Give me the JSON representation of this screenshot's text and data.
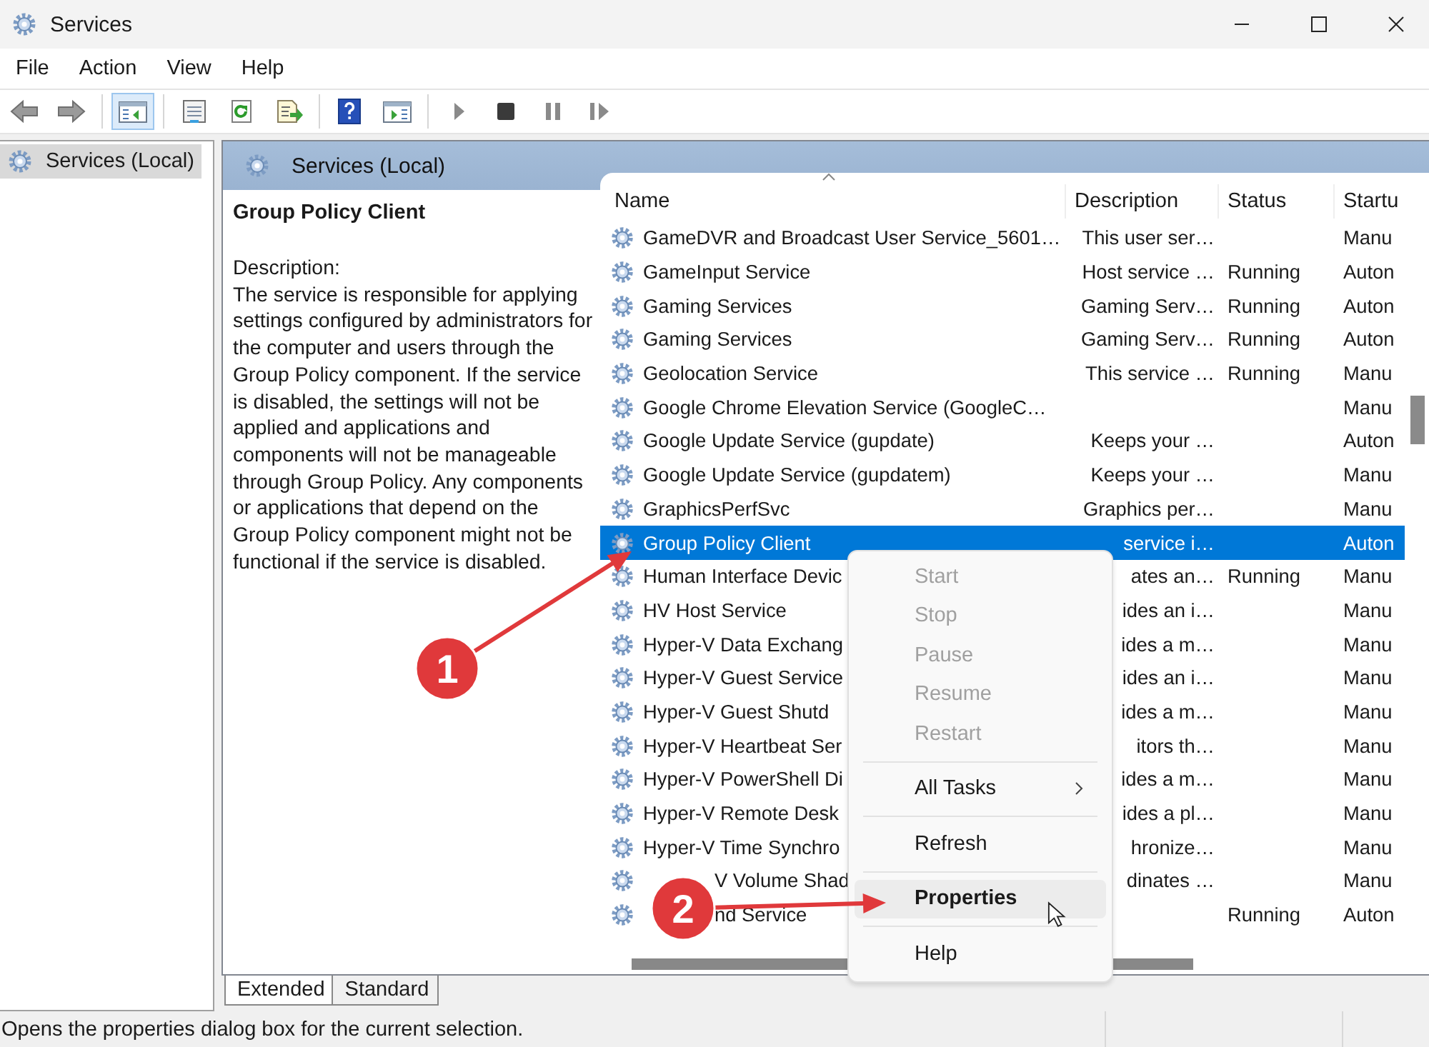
{
  "window": {
    "title": "Services"
  },
  "menu": [
    "File",
    "Action",
    "View",
    "Help"
  ],
  "toolbar": [
    {
      "kind": "back",
      "pressed": false
    },
    {
      "kind": "forward",
      "pressed": false
    },
    {
      "kind": "tree",
      "pressed": true
    },
    {
      "kind": "properties",
      "pressed": false
    },
    {
      "kind": "refresh",
      "pressed": false
    },
    {
      "kind": "export",
      "pressed": false
    },
    {
      "kind": "help",
      "pressed": false
    },
    {
      "kind": "pane",
      "pressed": false
    },
    {
      "kind": "play",
      "pressed": false
    },
    {
      "kind": "stop",
      "pressed": false
    },
    {
      "kind": "pause",
      "pressed": false
    },
    {
      "kind": "resume",
      "pressed": false
    }
  ],
  "tree": {
    "items": [
      {
        "label": "Services (Local)",
        "selected": true
      }
    ]
  },
  "pane_title": "Services (Local)",
  "detail": {
    "title": "Group Policy Client",
    "label": "Description:",
    "text": "The service is responsible for applying settings configured by administrators for the computer and users through the Group Policy component. If the service is disabled, the settings will not be applied and applications and components will not be manageable through Group Policy. Any components or applications that depend on the Group Policy component might not be functional if the service is disabled."
  },
  "table": {
    "columns": [
      "Name",
      "Description",
      "Status",
      "Startu"
    ],
    "rows": [
      {
        "name": "GameDVR and Broadcast User Service_5601…",
        "description": "This user ser…",
        "status": "",
        "startup": "Manu",
        "selected": false
      },
      {
        "name": "GameInput Service",
        "description": "Host service …",
        "status": "Running",
        "startup": "Auton",
        "selected": false
      },
      {
        "name": "Gaming Services",
        "description": "Gaming Serv…",
        "status": "Running",
        "startup": "Auton",
        "selected": false
      },
      {
        "name": "Gaming Services",
        "description": "Gaming Serv…",
        "status": "Running",
        "startup": "Auton",
        "selected": false
      },
      {
        "name": "Geolocation Service",
        "description": "This service …",
        "status": "Running",
        "startup": "Manu",
        "selected": false
      },
      {
        "name": "Google Chrome Elevation Service (GoogleC…",
        "description": "",
        "status": "",
        "startup": "Manu",
        "selected": false
      },
      {
        "name": "Google Update Service (gupdate)",
        "description": "Keeps your …",
        "status": "",
        "startup": "Auton",
        "selected": false
      },
      {
        "name": "Google Update Service (gupdatem)",
        "description": "Keeps your …",
        "status": "",
        "startup": "Manu",
        "selected": false
      },
      {
        "name": "GraphicsPerfSvc",
        "description": "Graphics per…",
        "status": "",
        "startup": "Manu",
        "selected": false
      },
      {
        "name": "Group Policy Client",
        "description": "service i…",
        "status": "",
        "startup": "Auton",
        "selected": true
      },
      {
        "name": "Human Interface Devic",
        "description": "ates an…",
        "status": "Running",
        "startup": "Manu",
        "selected": false
      },
      {
        "name": "HV Host Service",
        "description": "ides an i…",
        "status": "",
        "startup": "Manu",
        "selected": false
      },
      {
        "name": "Hyper-V Data Exchang",
        "description": "ides a m…",
        "status": "",
        "startup": "Manu",
        "selected": false
      },
      {
        "name": "Hyper-V Guest Service",
        "description": "ides an i…",
        "status": "",
        "startup": "Manu",
        "selected": false
      },
      {
        "name": "Hyper-V Guest Shutd",
        "description": "ides a m…",
        "status": "",
        "startup": "Manu",
        "selected": false
      },
      {
        "name": "Hyper-V Heartbeat Ser",
        "description": "itors th…",
        "status": "",
        "startup": "Manu",
        "selected": false
      },
      {
        "name": "Hyper-V PowerShell Di",
        "description": "ides a m…",
        "status": "",
        "startup": "Manu",
        "selected": false
      },
      {
        "name": "Hyper-V Remote Desk",
        "description": "ides a pl…",
        "status": "",
        "startup": "Manu",
        "selected": false
      },
      {
        "name": "Hyper-V Time Synchro",
        "description": "hronize…",
        "status": "",
        "startup": "Manu",
        "selected": false
      },
      {
        "name": "V Volume Shad",
        "description": "dinates …",
        "status": "",
        "startup": "Manu",
        "selected": false
      },
      {
        "name": "nd Service",
        "description": "",
        "status": "Running",
        "startup": "Auton",
        "selected": false
      }
    ]
  },
  "context_menu": [
    {
      "label": "Start",
      "disabled": true,
      "default": false,
      "highlighted": false,
      "submenu": false,
      "separator_before": false
    },
    {
      "label": "Stop",
      "disabled": true,
      "default": false,
      "highlighted": false,
      "submenu": false,
      "separator_before": false
    },
    {
      "label": "Pause",
      "disabled": true,
      "default": false,
      "highlighted": false,
      "submenu": false,
      "separator_before": false
    },
    {
      "label": "Resume",
      "disabled": true,
      "default": false,
      "highlighted": false,
      "submenu": false,
      "separator_before": false
    },
    {
      "label": "Restart",
      "disabled": true,
      "default": false,
      "highlighted": false,
      "submenu": false,
      "separator_before": false
    },
    {
      "label": "All Tasks",
      "disabled": false,
      "default": false,
      "highlighted": false,
      "submenu": true,
      "separator_before": true
    },
    {
      "label": "Refresh",
      "disabled": false,
      "default": false,
      "highlighted": false,
      "submenu": false,
      "separator_before": true
    },
    {
      "label": "Properties",
      "disabled": false,
      "default": true,
      "highlighted": true,
      "submenu": false,
      "separator_before": true
    },
    {
      "label": "Help",
      "disabled": false,
      "default": false,
      "highlighted": false,
      "submenu": false,
      "separator_before": true
    }
  ],
  "annotations": [
    {
      "label": "1"
    },
    {
      "label": "2"
    }
  ],
  "tabs": [
    {
      "label": "Extended",
      "selected": true
    },
    {
      "label": "Standard",
      "selected": false
    }
  ],
  "status_bar": "Opens the properties dialog box for the current selection."
}
